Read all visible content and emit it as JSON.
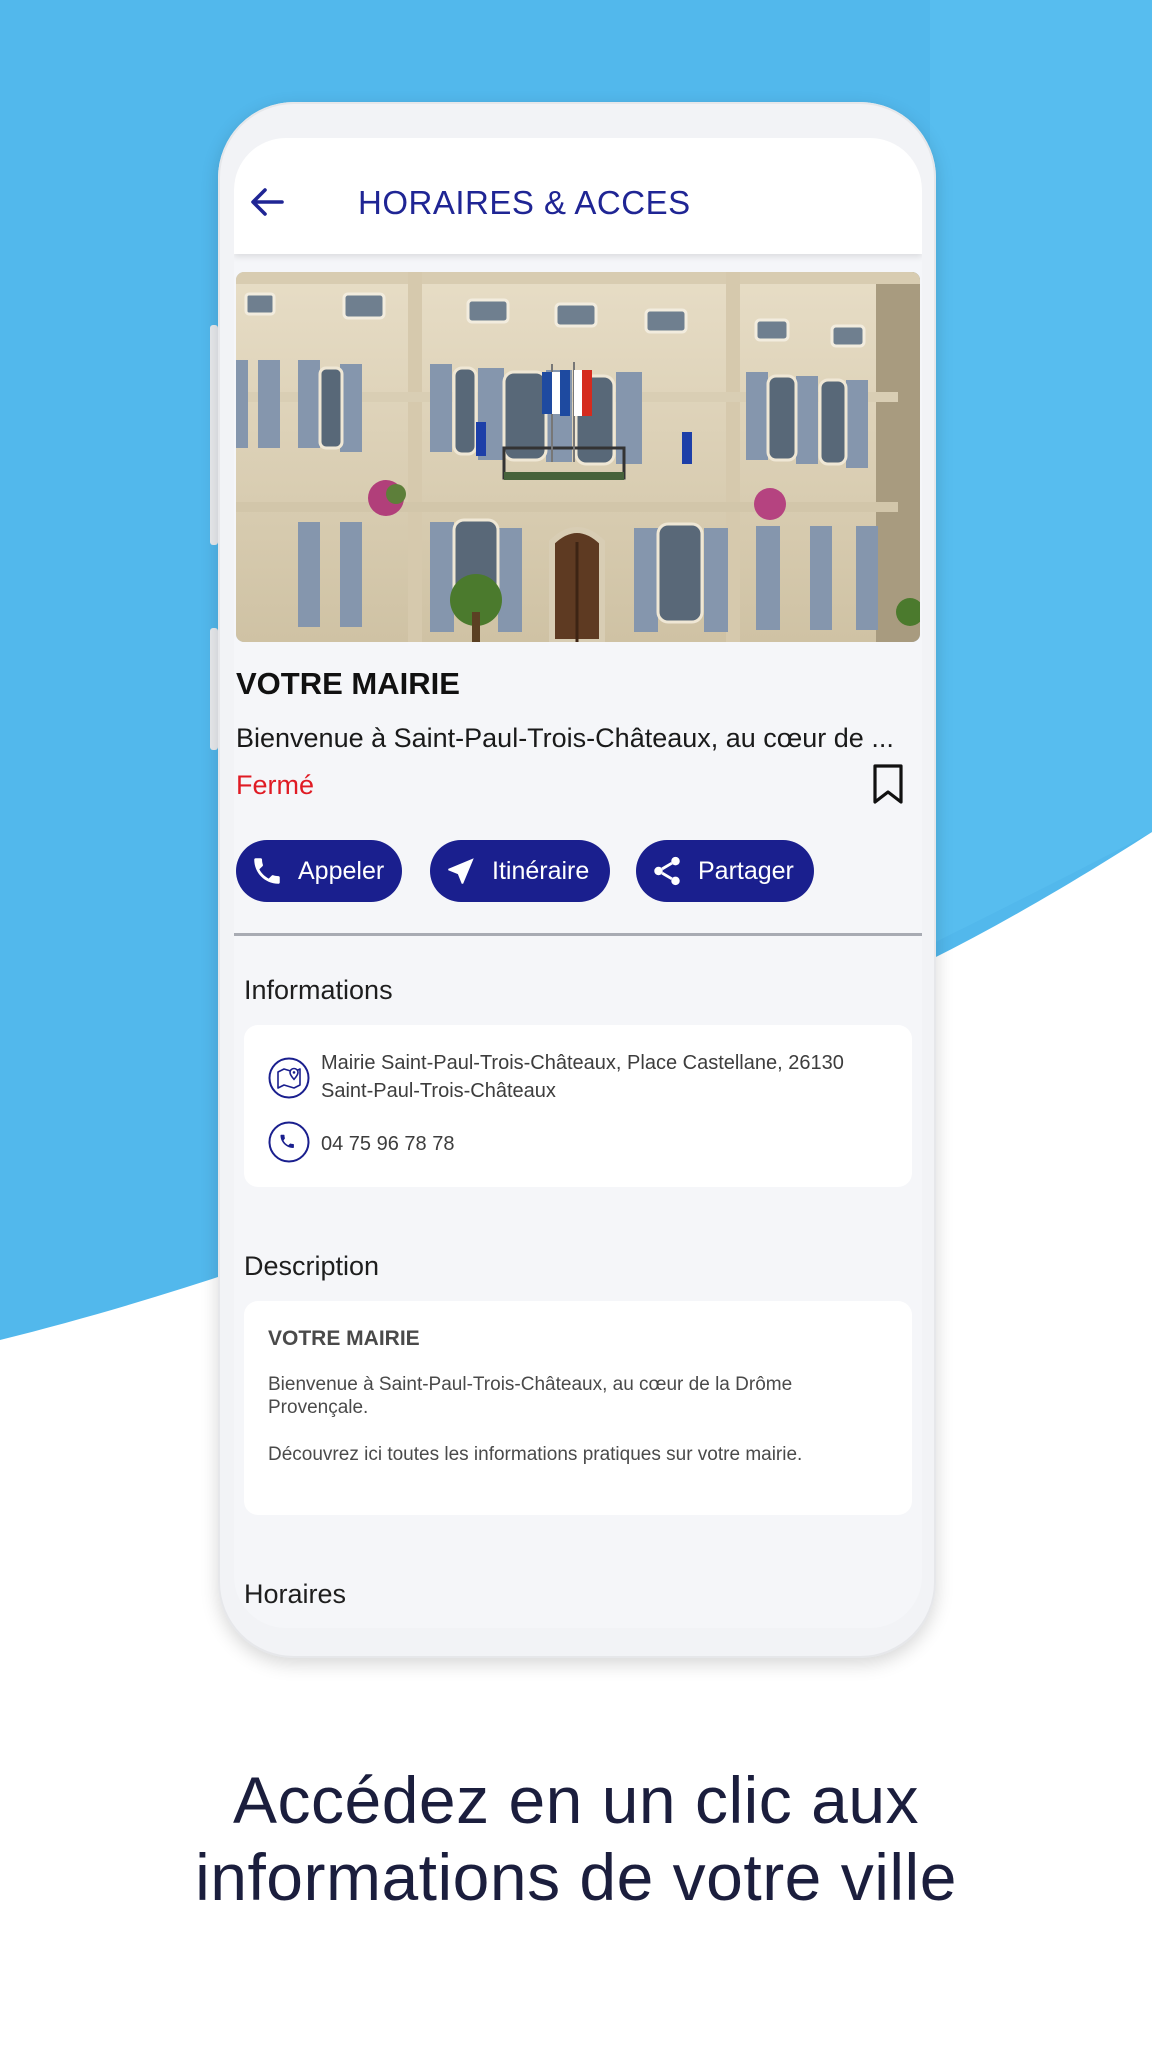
{
  "colors": {
    "background_blue": "#52b8ec",
    "accent_navy": "#1a1f8e",
    "closed_red": "#e01b24",
    "tagline": "#1b1e3d"
  },
  "appbar": {
    "title": "HORAIRES & ACCES",
    "back_icon": "arrow-left-icon"
  },
  "place": {
    "image_alt": "Mairie building facade with flags",
    "title": "VOTRE MAIRIE",
    "description_preview": "Bienvenue à Saint-Paul-Trois-Châteaux, au cœur de ...",
    "status": "Fermé",
    "bookmark_icon": "bookmark-icon"
  },
  "actions": [
    {
      "label": "Appeler",
      "icon": "phone-icon"
    },
    {
      "label": "Itinéraire",
      "icon": "navigation-icon"
    },
    {
      "label": "Partager",
      "icon": "share-icon"
    }
  ],
  "informations": {
    "title": "Informations",
    "address_line1": "Mairie Saint-Paul-Trois-Châteaux, Place Castellane, 26130",
    "address_line2": "Saint-Paul-Trois-Châteaux",
    "address_icon": "map-pin-icon",
    "phone": "04 75 96 78 78",
    "phone_icon": "phone-icon"
  },
  "description": {
    "title": "Description",
    "heading": "VOTRE MAIRIE",
    "para1_line1": "Bienvenue à Saint-Paul-Trois-Châteaux, au cœur de la Drôme",
    "para1_line2": "Provençale.",
    "para2": "Découvrez ici toutes les informations pratiques sur votre mairie."
  },
  "horaires": {
    "title": "Horaires"
  },
  "tagline": {
    "line1": "Accédez en un clic aux",
    "line2": "informations de votre ville"
  }
}
